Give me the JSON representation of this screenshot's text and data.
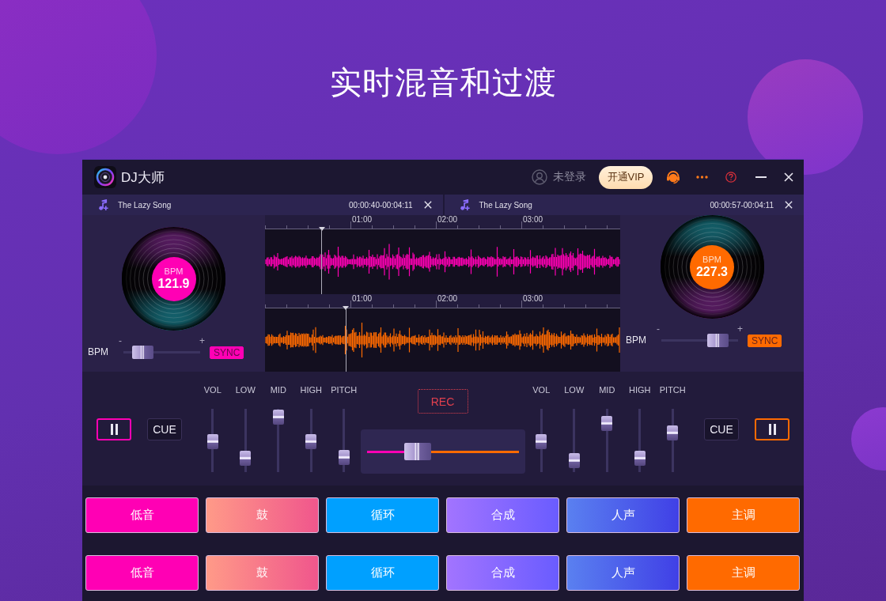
{
  "headline": "实时混音和过渡",
  "window": {
    "app_name": "DJ大师",
    "user_status": "未登录",
    "vip_button": "开通VIP"
  },
  "decks": [
    {
      "color": "#ff00b4",
      "track": {
        "title": "The Lazy Song",
        "time": "00:00:40-00:04:11"
      },
      "record": {
        "caption": "BPM",
        "bpm": "121.9"
      },
      "pitch": {
        "label": "BPM",
        "minus": "-",
        "plus": "+",
        "level": 0.15,
        "sync": "SYNC"
      },
      "waveform": {
        "ticks": [
          "01:00",
          "02:00",
          "03:00"
        ],
        "level": 0.16
      },
      "cue": "CUE",
      "faders": [
        {
          "label": "VOL",
          "level": 0.48
        },
        {
          "label": "LOW",
          "level": 0.13
        },
        {
          "label": "MID",
          "level": 0.98
        },
        {
          "label": "HIGH",
          "level": 0.48
        },
        {
          "label": "PITCH",
          "level": 0.15
        }
      ]
    },
    {
      "color": "#ff6a00",
      "track": {
        "title": "The Lazy Song",
        "time": "00:00:57-00:04:11"
      },
      "record": {
        "caption": "BPM",
        "bpm": "227.3"
      },
      "pitch": {
        "label": "BPM",
        "minus": "-",
        "plus": "+",
        "level": 0.83,
        "sync": "SYNC"
      },
      "waveform": {
        "ticks": [
          "01:00",
          "02:00",
          "03:00"
        ],
        "level": 0.228
      },
      "cue": "CUE",
      "faders": [
        {
          "label": "VOL",
          "level": 0.48
        },
        {
          "label": "LOW",
          "level": 0.08
        },
        {
          "label": "MID",
          "level": 0.85
        },
        {
          "label": "HIGH",
          "level": 0.13
        },
        {
          "label": "PITCH",
          "level": 0.66
        }
      ]
    }
  ],
  "rec_button": "REC",
  "crossfader": {
    "level": 0.3
  },
  "pad_rows": [
    [
      {
        "label": "低音",
        "color": "#ff00b4"
      },
      {
        "label": "鼓",
        "gradient": [
          {
            "color": "#ff9a88"
          },
          {
            "color": "#f0568c"
          }
        ]
      },
      {
        "label": "循环",
        "color": "#00a0ff"
      },
      {
        "label": "合成",
        "gradient": [
          {
            "color": "#a274ff"
          },
          {
            "color": "#6a5cff"
          }
        ]
      },
      {
        "label": "人声",
        "gradient": [
          {
            "color": "#5a80f0"
          },
          {
            "color": "#4040e6"
          }
        ]
      },
      {
        "label": "主调",
        "color": "#ff6a00"
      }
    ],
    [
      {
        "label": "低音",
        "color": "#ff00b4"
      },
      {
        "label": "鼓",
        "gradient": [
          {
            "color": "#ff9a88"
          },
          {
            "color": "#f0568c"
          }
        ]
      },
      {
        "label": "循环",
        "color": "#00a0ff"
      },
      {
        "label": "合成",
        "gradient": [
          {
            "color": "#a274ff"
          },
          {
            "color": "#6a5cff"
          }
        ]
      },
      {
        "label": "人声",
        "gradient": [
          {
            "color": "#5a80f0"
          },
          {
            "color": "#4040e6"
          }
        ]
      },
      {
        "label": "主调",
        "color": "#ff6a00"
      }
    ]
  ]
}
